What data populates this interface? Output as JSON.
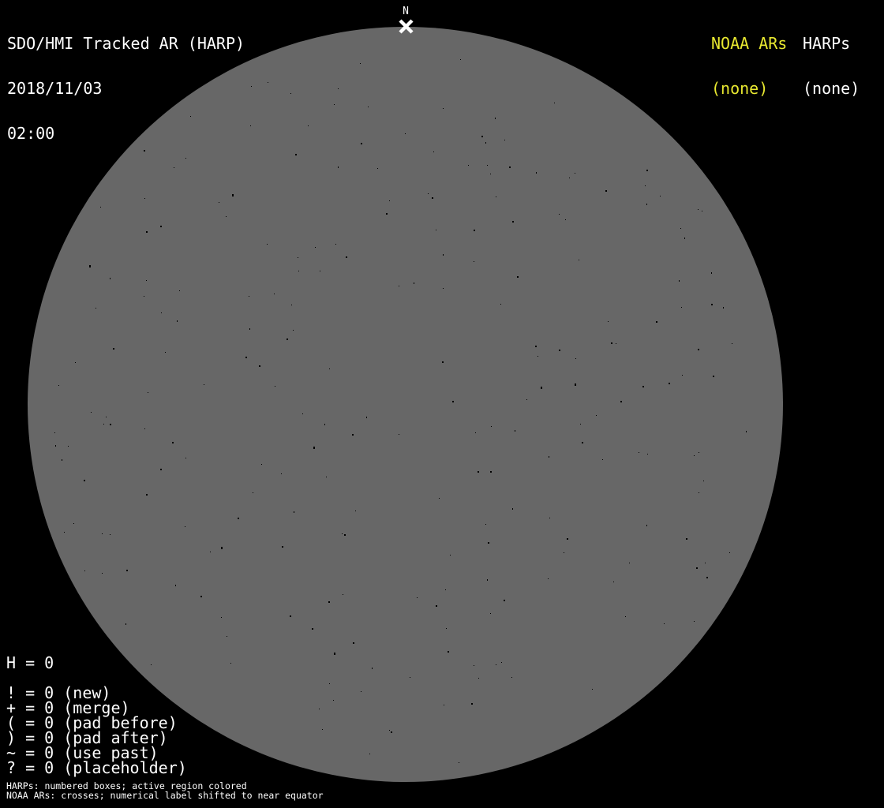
{
  "header": {
    "title": "SDO/HMI Tracked AR (HARP)",
    "date": "2018/11/03",
    "time": "02:00"
  },
  "top_right": {
    "noaa_label": "NOAA ARs",
    "noaa_value": "(none)",
    "noaa_color": "#e8e830",
    "harps_label": "HARPs",
    "harps_value": "(none)",
    "harps_color": "#ffffff"
  },
  "disk": {
    "color": "#676767",
    "north_label": "N",
    "specks": {
      "count": 240,
      "color": "#000000",
      "seed": 20181103
    }
  },
  "legend": {
    "lines": [
      "H = 0",
      "",
      "! = 0 (new)",
      "+ = 0 (merge)",
      "( = 0 (pad before)",
      ") = 0 (pad after)",
      "~ = 0 (use past)",
      "? = 0 (placeholder)"
    ]
  },
  "footer": {
    "lines": [
      "HARPs: numbered boxes; active region colored",
      "NOAA ARs: crosses; numerical label shifted to near equator"
    ]
  },
  "chart_data": {
    "type": "scatter",
    "title": "SDO/HMI Tracked AR (HARP)",
    "observation_datetime": "2018/11/03 02:00",
    "harps": [],
    "noaa_ars": [],
    "counts": {
      "H": 0,
      "new": 0,
      "merge": 0,
      "pad_before": 0,
      "pad_after": 0,
      "use_past": 0,
      "placeholder": 0
    },
    "annotations": [
      "N cross marker at solar north pole"
    ],
    "legend_position": "bottom-left",
    "grid": false
  }
}
